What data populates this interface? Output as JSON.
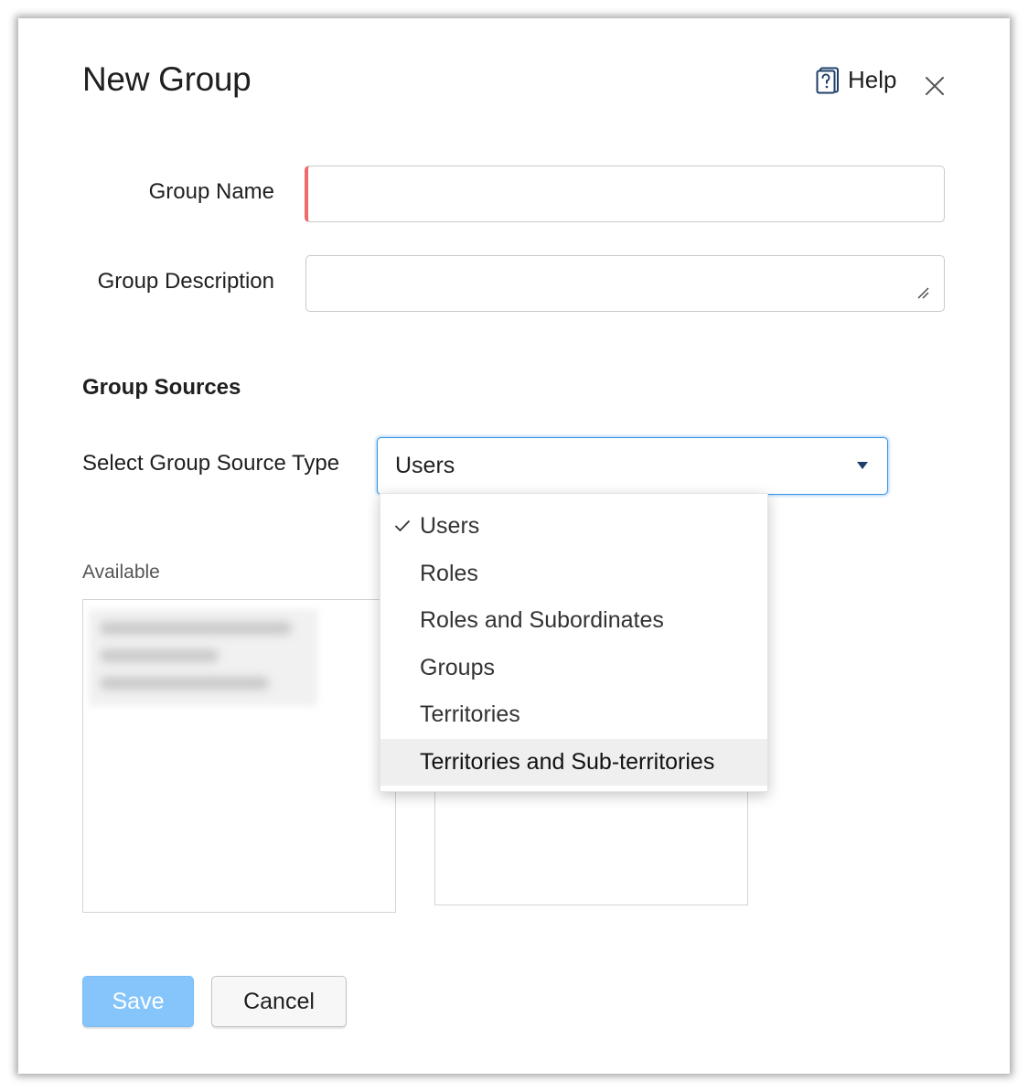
{
  "dialog": {
    "title": "New Group",
    "help_label": "Help"
  },
  "form": {
    "group_name_label": "Group Name",
    "group_name_value": "",
    "group_description_label": "Group Description",
    "group_description_value": ""
  },
  "sources": {
    "section_title": "Group Sources",
    "source_type_label": "Select Group Source Type",
    "selected_value": "Users",
    "options": [
      {
        "label": "Users",
        "selected": true
      },
      {
        "label": "Roles",
        "selected": false
      },
      {
        "label": "Roles and Subordinates",
        "selected": false
      },
      {
        "label": "Groups",
        "selected": false
      },
      {
        "label": "Territories",
        "selected": false
      },
      {
        "label": "Territories and Sub-territories",
        "selected": false,
        "hovered": true
      }
    ],
    "available_label": "Available"
  },
  "actions": {
    "save_label": "Save",
    "cancel_label": "Cancel"
  },
  "colors": {
    "accent": "#3a93e6",
    "required_marker": "#ef6b6b",
    "save_button": "#86c5fb",
    "menu_hover": "#efefef"
  },
  "icons": {
    "help": "help-book-icon",
    "close": "close-icon",
    "dropdown": "caret-down-icon",
    "selected": "checkmark-icon",
    "resize": "resize-grip-icon"
  }
}
